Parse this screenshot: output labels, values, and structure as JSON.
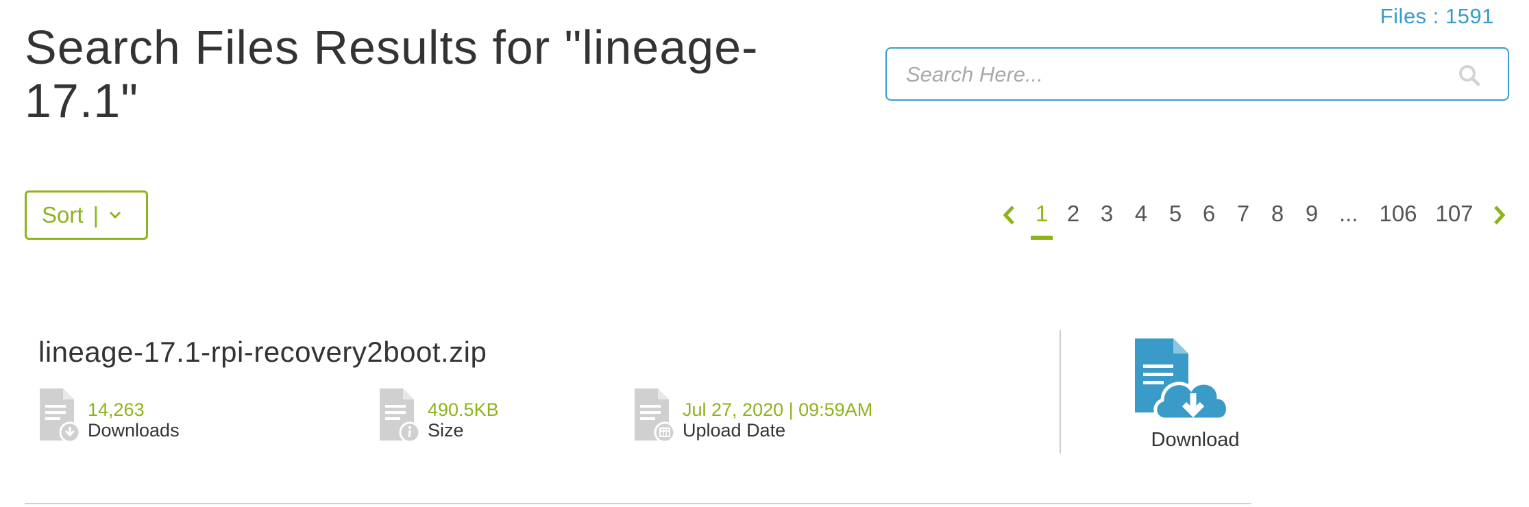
{
  "header": {
    "title": "Search Files Results for \"lineage-17.1\"",
    "files_count": "Files : 1591"
  },
  "search": {
    "placeholder": "Search Here..."
  },
  "sort": {
    "label": "Sort",
    "separator": "|"
  },
  "pagination": {
    "items": [
      "1",
      "2",
      "3",
      "4",
      "5",
      "6",
      "7",
      "8",
      "9",
      "...",
      "106",
      "107"
    ],
    "current": "1"
  },
  "result": {
    "file_name": "lineage-17.1-rpi-recovery2boot.zip",
    "downloads_value": "14,263",
    "downloads_label": "Downloads",
    "size_value": "490.5KB",
    "size_label": "Size",
    "date_value": "Jul 27, 2020 | 09:59AM",
    "date_label": "Upload Date",
    "download_label": "Download"
  },
  "colors": {
    "accent_green": "#8db31a",
    "accent_blue": "#3a9bc9",
    "icon_grey": "#d0d0d0"
  },
  "icons": [
    "search-icon",
    "chevron-down-icon",
    "chevron-left-icon",
    "chevron-right-icon",
    "file-download-icon",
    "file-info-icon",
    "file-calendar-icon",
    "cloud-download-icon"
  ]
}
